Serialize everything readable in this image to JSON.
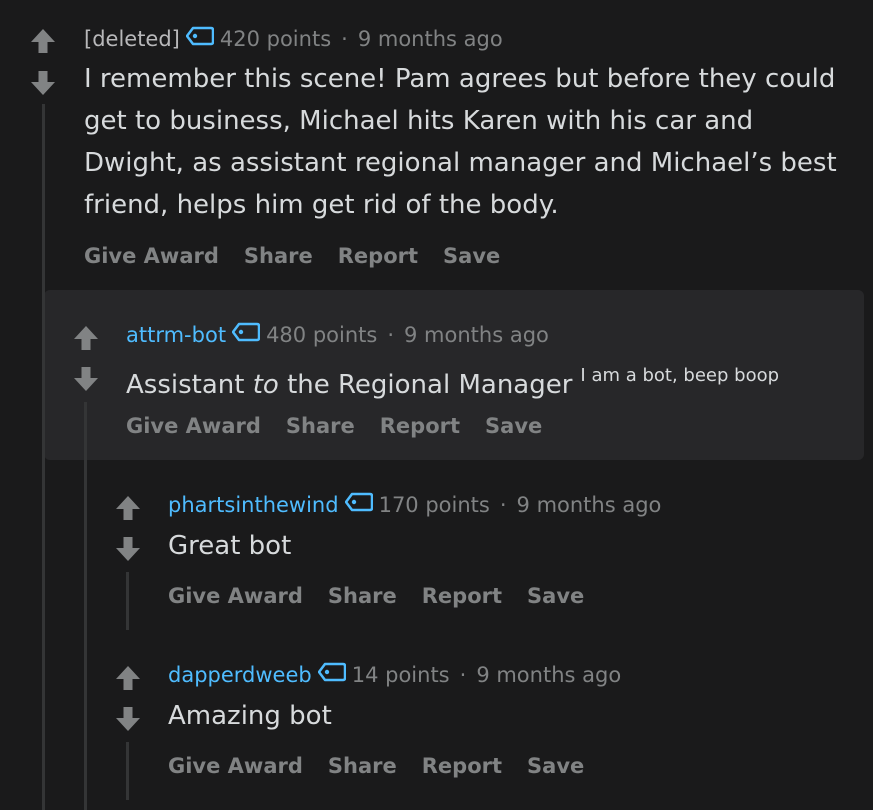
{
  "comments": [
    {
      "author": "[deleted]",
      "points": "420 points",
      "separator": "·",
      "time": "9 months ago",
      "body": "I remember this scene! Pam agrees but before they could get to business, Michael hits Karen with his car and Dwight, as assistant regional manager and Michael’s best friend, helps him get rid of the body."
    },
    {
      "author": "attrm-bot",
      "points": "480 points",
      "separator": "·",
      "time": "9 months ago",
      "body_before": "Assistant ",
      "body_em": "to",
      "body_after": " the Regional Manager",
      "superscript": "I am a bot, beep boop"
    },
    {
      "author": "phartsinthewind",
      "points": "170 points",
      "separator": "·",
      "time": "9 months ago",
      "body": "Great bot"
    },
    {
      "author": "dapperdweeb",
      "points": "14 points",
      "separator": "·",
      "time": "9 months ago",
      "body": "Amazing bot"
    }
  ],
  "actions": {
    "give_award": "Give Award",
    "share": "Share",
    "report": "Report",
    "save": "Save"
  },
  "icons": {
    "upvote": "upvote-arrow-icon",
    "downvote": "downvote-arrow-icon",
    "flair": "tag-icon"
  },
  "colors": {
    "background": "#1a1a1b",
    "highlight_background": "#272729",
    "author_link": "#4fbcff",
    "muted": "#818384",
    "body": "#d7dadc"
  }
}
